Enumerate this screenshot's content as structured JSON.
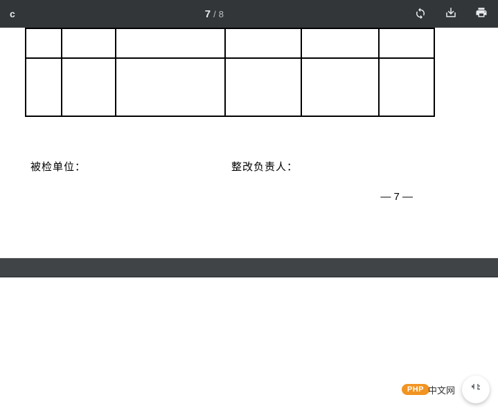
{
  "toolbar": {
    "title": "c",
    "current_page": "7",
    "page_separator": "/",
    "total_pages": "8"
  },
  "labels": {
    "inspected_unit": "被检单位：",
    "rectification_person": "整改负责人："
  },
  "footer": {
    "page_marker": "— 7 —"
  },
  "badge": {
    "php": "PHP",
    "cn": "中文网"
  }
}
